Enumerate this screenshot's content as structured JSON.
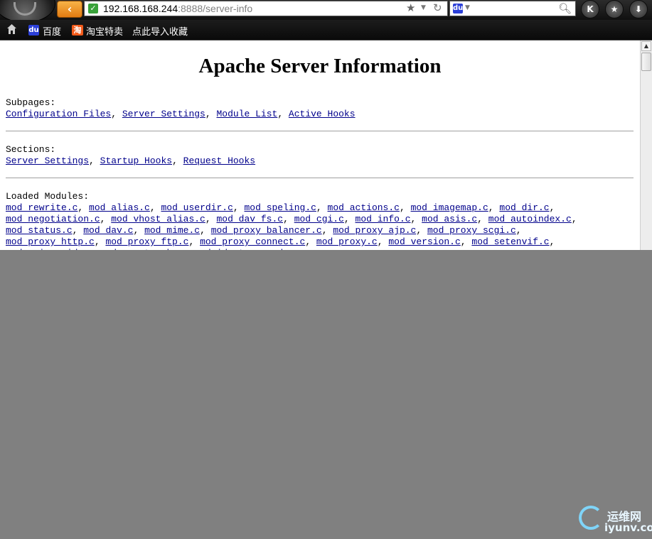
{
  "navbar": {
    "url_host": "192.168.168.244",
    "url_rest": ":8888/server-info",
    "buttons": {
      "k_label": "K",
      "star_label": "★",
      "download_label": "⬇"
    }
  },
  "bookmarks": {
    "items": [
      {
        "label": "百度"
      },
      {
        "label": "淘宝特卖"
      },
      {
        "label": "点此导入收藏"
      }
    ]
  },
  "page": {
    "title": "Apache Server Information",
    "subpages": {
      "label": "Subpages:",
      "links": [
        "Configuration Files",
        "Server Settings",
        "Module List",
        "Active Hooks"
      ]
    },
    "sections": {
      "label": "Sections:",
      "links": [
        "Server Settings",
        "Startup Hooks",
        "Request Hooks"
      ]
    },
    "loaded_modules": {
      "label": "Loaded Modules:",
      "rows": [
        [
          "mod_rewrite.c",
          "mod_alias.c",
          "mod_userdir.c",
          "mod_speling.c",
          "mod_actions.c",
          "mod_imagemap.c",
          "mod_dir.c"
        ],
        [
          "mod_negotiation.c",
          "mod_vhost_alias.c",
          "mod_dav_fs.c",
          "mod_cgi.c",
          "mod_info.c",
          "mod_asis.c",
          "mod_autoindex.c"
        ],
        [
          "mod_status.c",
          "mod_dav.c",
          "mod_mime.c",
          "mod_proxy_balancer.c",
          "mod_proxy_ajp.c",
          "mod_proxy_scgi.c"
        ],
        [
          "mod_proxy_http.c",
          "mod_proxy_ftp.c",
          "mod_proxy_connect.c",
          "mod_proxy.c",
          "mod_version.c",
          "mod_setenvif.c"
        ],
        [
          "mod_unique_id.c",
          "mod_usertrack.c",
          "mod_ident.c",
          "mod"
        ]
      ]
    }
  },
  "watermark": {
    "line1": "运维网",
    "line2": "iyunv.com"
  },
  "colors": {
    "link": "#00008b",
    "back_button": "#f0941f",
    "overlay": "#808080"
  }
}
